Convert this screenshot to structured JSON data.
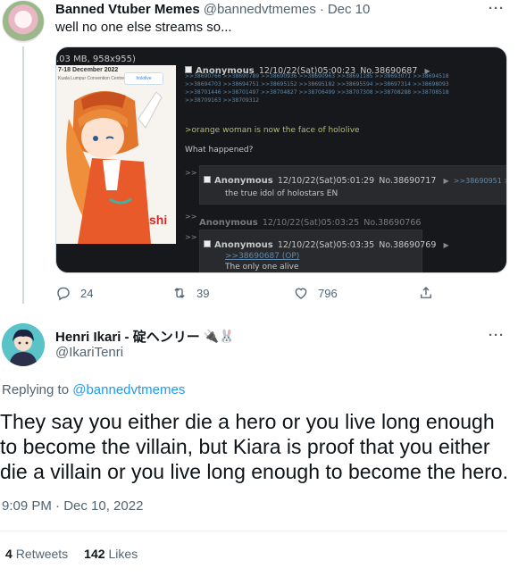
{
  "parent_tweet": {
    "author_name": "Banned Vtuber Memes",
    "handle": "@bannedvtmemes",
    "separator": "·",
    "date": "Dec 10",
    "more": "···",
    "text": "well no one else streams so...",
    "media": {
      "file_info": ".03 MB, 958x955)",
      "poster_date": "7-18 December 2022",
      "poster_venue": "Kuala Lumpur Convention Centre",
      "poster_logo": "hololive",
      "op": {
        "name": "Anonymous",
        "datetime": "12/10/22(Sat)05:00:23",
        "number": "No.38690687",
        "arrow": "▶",
        "backlinks": ">>38690766 >>38690789 >>38690936 >>38690963 >>38691185 >>38693071 >>38694518 >>38694703 >>38694751 >>38695152 >>38695182 >>38695594 >>38697314 >>38698093 >>38701446 >>38701497 >>38704827 >>38706499 >>38707308 >>38708288 >>38708518 >>38709163 >>38709312",
        "greentext": ">orange woman is now the face of hololive",
        "question": "What happened?"
      },
      "replies": [
        {
          "gt": ">>",
          "name": "Anonymous",
          "datetime": "12/10/22(Sat)05:01:29",
          "number": "No.38690717",
          "arrow": "▶",
          "links": ">>38690951 >>38690",
          "body": "the true idol of holostars EN"
        },
        {
          "gt": ">>",
          "name": "Anonymous",
          "datetime": "12/10/22(Sat)05:03:25",
          "number": "No.38690766"
        },
        {
          "gt": ">>",
          "name": "Anonymous",
          "datetime": "12/10/22(Sat)05:03:35",
          "number": "No.38690769",
          "arrow": "▶",
          "quote": ">>38690687 (OP)",
          "body": "The only one alive"
        }
      ]
    },
    "actions": {
      "replies": "24",
      "retweets": "39",
      "likes": "796"
    }
  },
  "focal_tweet": {
    "author_name": "Henri Ikari - 碇ヘンリー",
    "name_emoji": "🔌🐰",
    "handle": "@IkariTenri",
    "more": "···",
    "replying_prefix": "Replying to",
    "replying_handle": "@bannedvtmemes",
    "text": "They say you either die a hero or you live long enough to become the villain, but Kiara is proof that you either die a villain or you live long enough to become the hero.",
    "timestamp": "9:09 PM · Dec 10, 2022",
    "retweet_count": "4",
    "retweet_label": "Retweets",
    "like_count": "142",
    "like_label": "Likes"
  }
}
